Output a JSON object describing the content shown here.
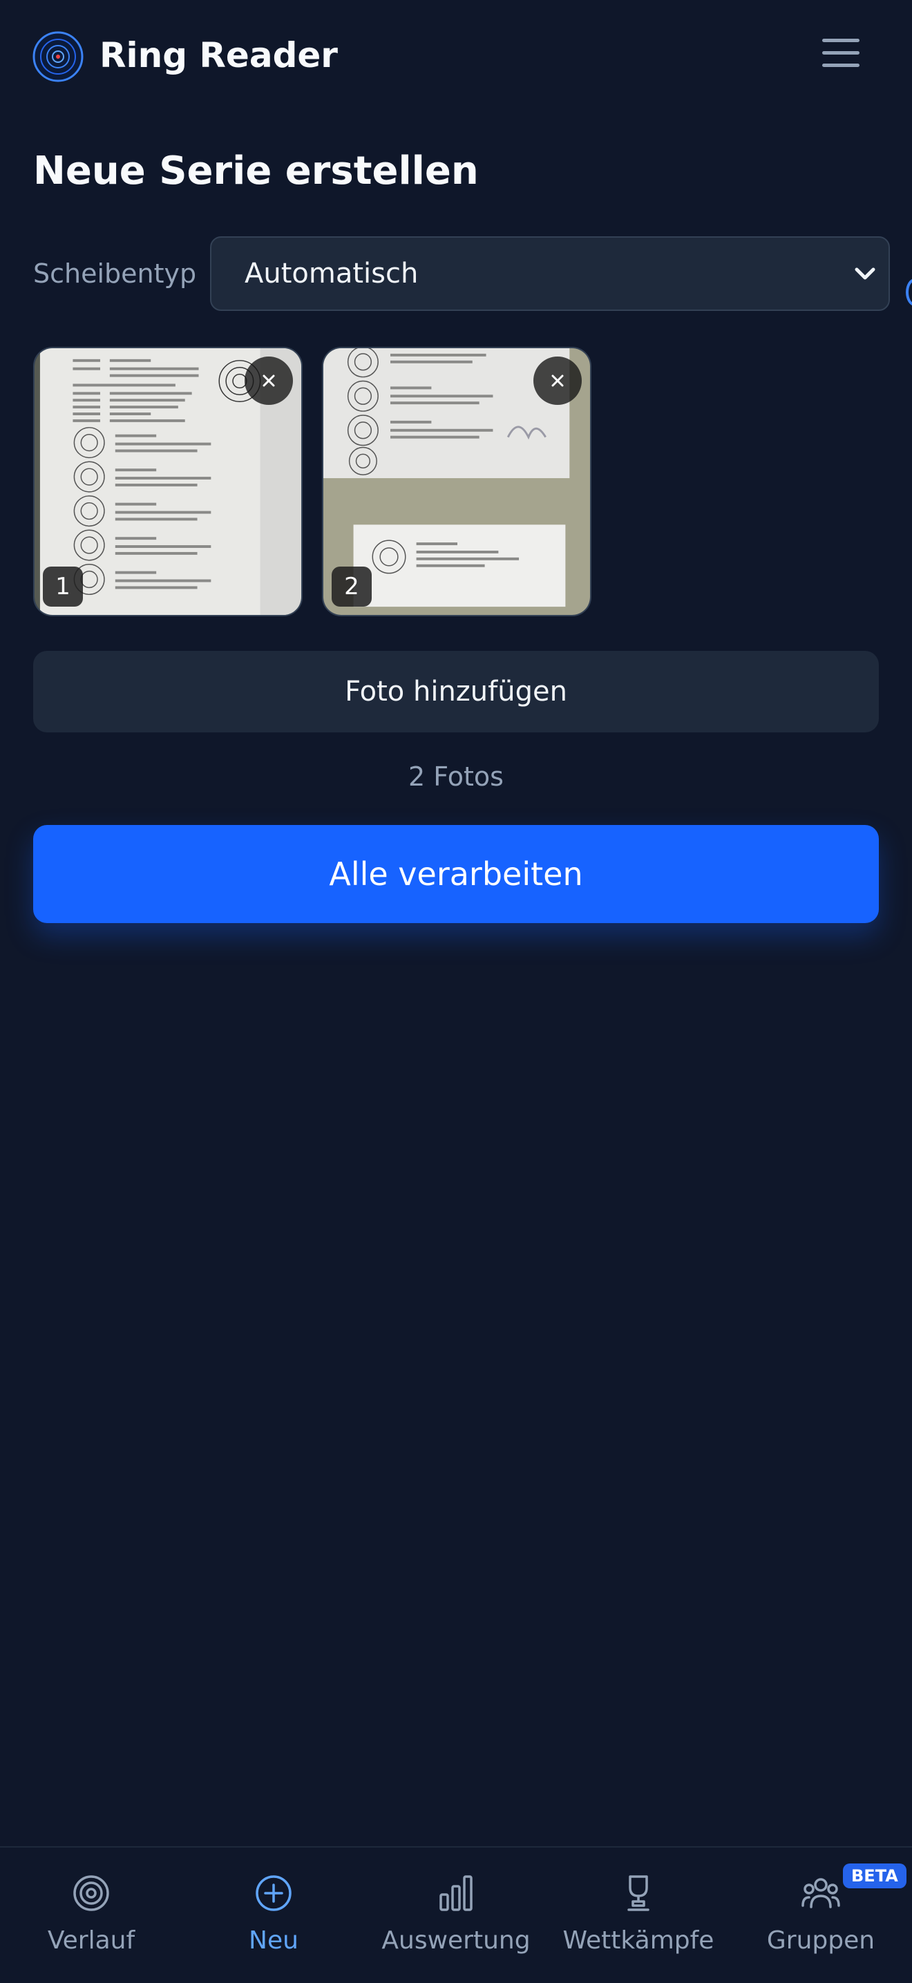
{
  "app": {
    "title": "Ring Reader"
  },
  "header": {
    "logo_icon": "target-logo-icon",
    "menu_icon": "hamburger-menu-icon"
  },
  "page": {
    "title": "Neue Serie erstellen"
  },
  "form": {
    "disc_type_label": "Scheibentyp",
    "disc_type_value": "Automatisch"
  },
  "photos": [
    {
      "number": "1"
    },
    {
      "number": "2"
    }
  ],
  "actions": {
    "add_photo": "Foto hinzufügen",
    "photo_count": "2 Fotos",
    "process_all": "Alle verarbeiten"
  },
  "nav": {
    "items": [
      {
        "label": "Verlauf",
        "icon": "target-icon",
        "active": false
      },
      {
        "label": "Neu",
        "icon": "plus-circle-icon",
        "active": true
      },
      {
        "label": "Auswertung",
        "icon": "bar-chart-icon",
        "active": false
      },
      {
        "label": "Wettkämpfe",
        "icon": "trophy-icon",
        "active": false
      },
      {
        "label": "Gruppen",
        "icon": "users-icon",
        "active": false
      }
    ],
    "beta_badge": "BETA"
  },
  "colors": {
    "background": "#0f172a",
    "surface": "#1e293b",
    "accent": "#1763ff",
    "active_nav": "#60a5fa",
    "muted_text": "#94a3b8"
  }
}
